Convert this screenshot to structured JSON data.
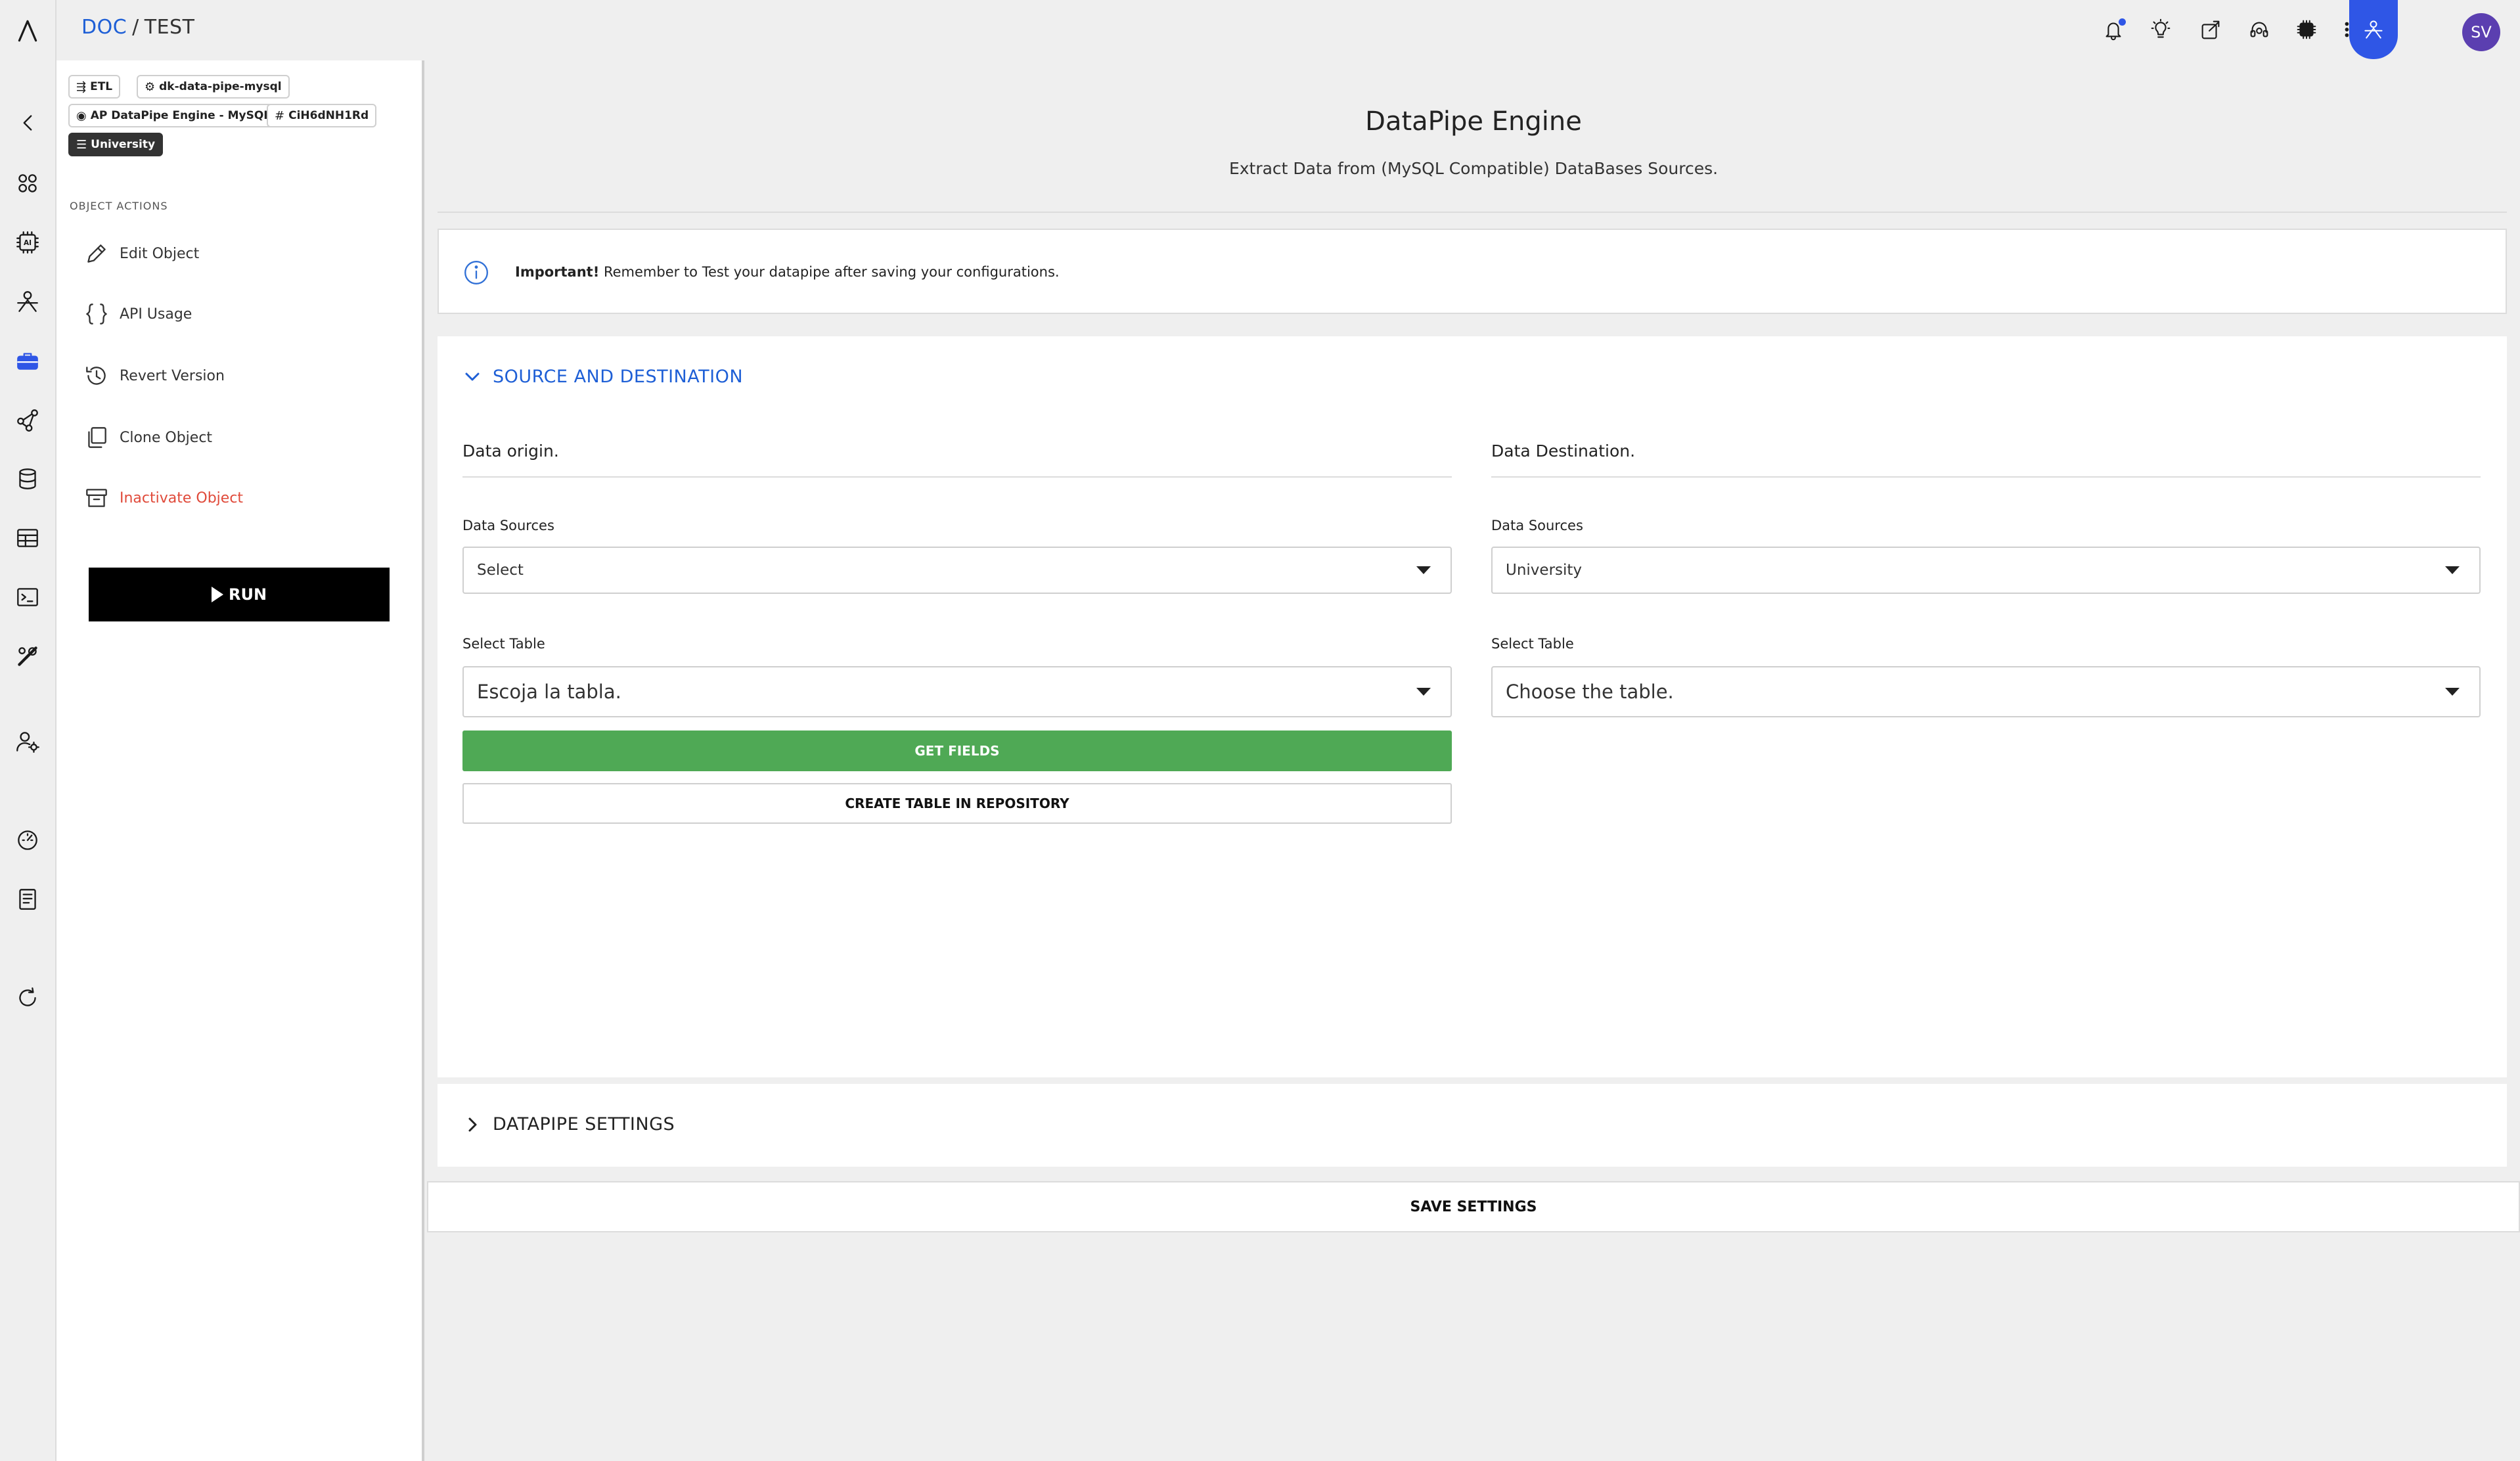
{
  "breadcrumb": {
    "link": "DOC",
    "separator": "/",
    "current": "TEST"
  },
  "user": {
    "initials": "SV"
  },
  "tags": {
    "etl": "ETL",
    "pipe": "dk-data-pipe-mysql",
    "engine": "AP DataPipe Engine - MySQL",
    "id": "CiH6dNH1Rd",
    "db": "University"
  },
  "panel": {
    "section_label": "OBJECT ACTIONS",
    "actions": {
      "edit": "Edit Object",
      "api": "API Usage",
      "revert": "Revert Version",
      "clone": "Clone Object",
      "inactivate": "Inactivate Object"
    },
    "run_label": "RUN"
  },
  "header": {
    "title": "DataPipe Engine",
    "subtitle": "Extract Data from (MySQL Compatible) DataBases Sources."
  },
  "alert": {
    "strong": "Important!",
    "text": " Remember to Test your datapipe after saving your configurations."
  },
  "source_dest": {
    "heading": "SOURCE AND DESTINATION",
    "origin": {
      "title": "Data origin.",
      "sources_label": "Data Sources",
      "sources_value": "Select",
      "table_label": "Select Table",
      "table_value": "Escoja la tabla.",
      "get_fields": "GET FIELDS",
      "create_table": "CREATE TABLE IN REPOSITORY"
    },
    "destination": {
      "title": "Data Destination.",
      "sources_label": "Data Sources",
      "sources_value": "University",
      "table_label": "Select Table",
      "table_value": "Choose the table."
    }
  },
  "settings": {
    "heading": "DATAPIPE SETTINGS"
  },
  "save_label": "SAVE SETTINGS",
  "colors": {
    "accent": "#2f56e6",
    "link": "#1e5fd6",
    "success": "#4fa955",
    "danger": "#e04a3a",
    "avatar": "#5b3fb0"
  }
}
